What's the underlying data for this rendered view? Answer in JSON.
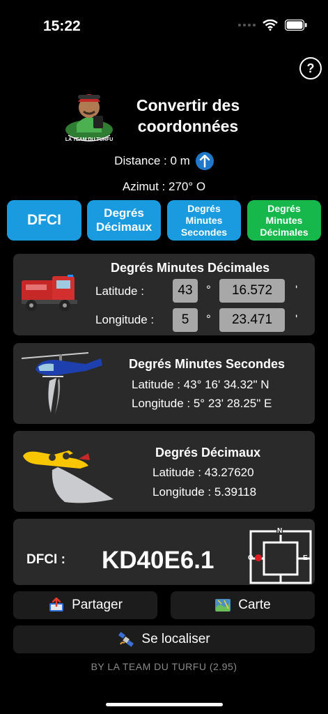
{
  "status_bar": {
    "time": "15:22"
  },
  "header": {
    "help_label": "?",
    "title_line1": "Convertir des",
    "title_line2": "coordonnées",
    "logo_text": "LA TEAM DU TURFU"
  },
  "distance": {
    "text": "Distance : 0 m"
  },
  "azimut": {
    "text": "Azimut : 270° O"
  },
  "modes": [
    {
      "label": "DFCI",
      "color": "#1a9be0"
    },
    {
      "label": "Degrés Décimaux",
      "color": "#1a9be0"
    },
    {
      "label": "Degrés Minutes Secondes",
      "color": "#1a9be0"
    },
    {
      "label": "Degrés Minutes Décimales",
      "color": "#16b84c"
    }
  ],
  "dmd": {
    "title": "Degrés Minutes Décimales",
    "lat_label": "Latitude :",
    "lat_deg": "43",
    "lat_min": "16.572",
    "lon_label": "Longitude :",
    "lon_deg": "5",
    "lon_min": "23.471",
    "deg_symbol": "°",
    "min_symbol": "'"
  },
  "dms": {
    "title": "Degrés Minutes Secondes",
    "latitude": "Latitude : 43° 16' 34.32\" N",
    "longitude": "Longitude : 5° 23' 28.25\" E"
  },
  "dd": {
    "title": "Degrés Décimaux",
    "latitude": "Latitude : 43.27620",
    "longitude": "Longitude : 5.39118"
  },
  "dfci": {
    "label": "DFCI :",
    "code": "KD40E6.1",
    "compass_n": "N",
    "compass_o": "O",
    "compass_e": "E"
  },
  "actions": {
    "share_label": "Partager",
    "map_label": "Carte",
    "locate_label": "Se localiser"
  },
  "footer": {
    "text": "BY LA TEAM DU TURFU (2.95)"
  }
}
